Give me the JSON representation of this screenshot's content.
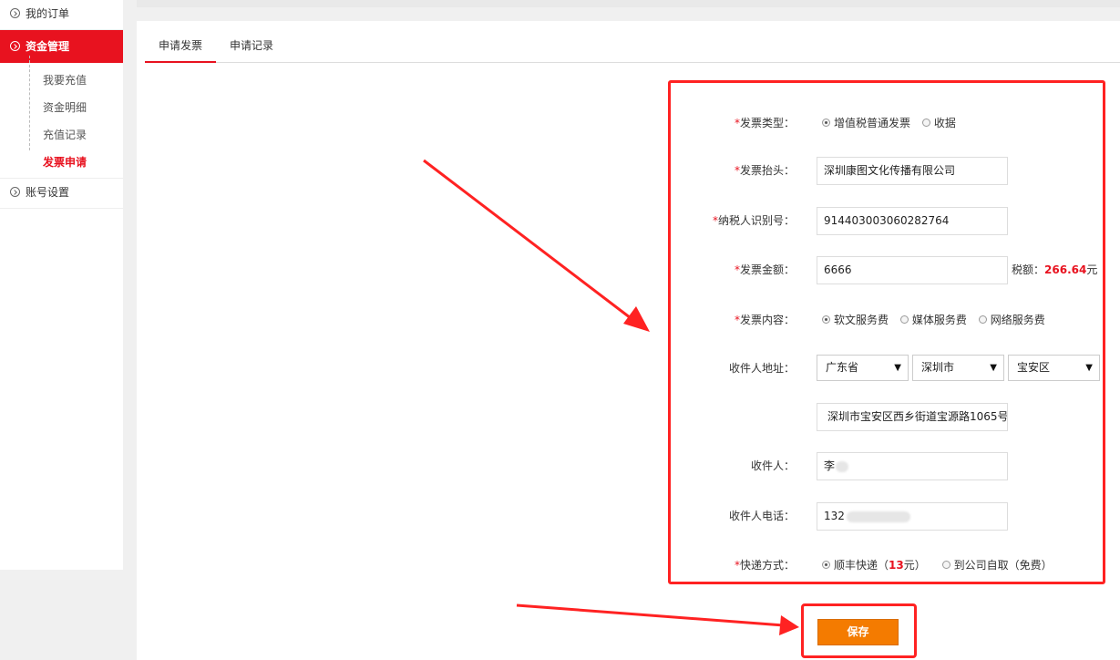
{
  "sidebar": {
    "orders": "我的订单",
    "funds": "资金管理",
    "sub": [
      "我要充值",
      "资金明细",
      "充值记录",
      "发票申请"
    ],
    "account": "账号设置"
  },
  "tabs": [
    "申请发票",
    "申请记录"
  ],
  "form": {
    "invoice_type": {
      "label": "发票类型：",
      "options": [
        "增值税普通发票",
        "收据"
      ]
    },
    "title": {
      "label": "发票抬头：",
      "value": "深圳康图文化传播有限公司"
    },
    "tax_id": {
      "label": "纳税人识别号：",
      "value": "914403003060282764"
    },
    "amount": {
      "label": "发票金额：",
      "value": "6666",
      "tax_label": "税额：",
      "tax_value": "266.64",
      "tax_unit": "元"
    },
    "content": {
      "label": "发票内容：",
      "options": [
        "软文服务费",
        "媒体服务费",
        "网络服务费"
      ]
    },
    "address": {
      "label": "收件人地址：",
      "province": "广东省",
      "city": "深圳市",
      "district": "宝安区",
      "detail": "深圳市宝安区西乡街道宝源路1065号"
    },
    "recipient": {
      "label": "收件人：",
      "value": "李"
    },
    "phone": {
      "label": "收件人电话：",
      "value": "132"
    },
    "shipping": {
      "label": "快递方式：",
      "opt1_prefix": "顺丰快递（",
      "opt1_price": "13",
      "opt1_suffix": "元）",
      "opt2": "到公司自取（免费）"
    }
  },
  "save_label": "保存",
  "colors": {
    "accent": "#e8121f",
    "button": "#f47b00",
    "annotation": "#ff2222"
  }
}
